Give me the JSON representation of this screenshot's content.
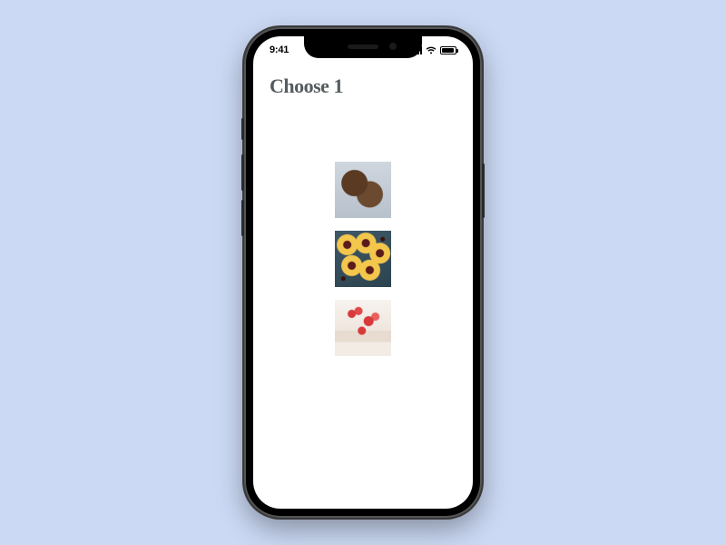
{
  "background_color": "#cbd9f4",
  "status_bar": {
    "time": "9:41",
    "signal_bars": 4,
    "wifi": true,
    "battery_icon": "battery-full"
  },
  "page": {
    "title": "Choose 1"
  },
  "options": [
    {
      "id": "cookies",
      "thumb_class": "thumb-cookies"
    },
    {
      "id": "tarts",
      "thumb_class": "thumb-tarts"
    },
    {
      "id": "parfait",
      "thumb_class": "thumb-parfait"
    }
  ]
}
